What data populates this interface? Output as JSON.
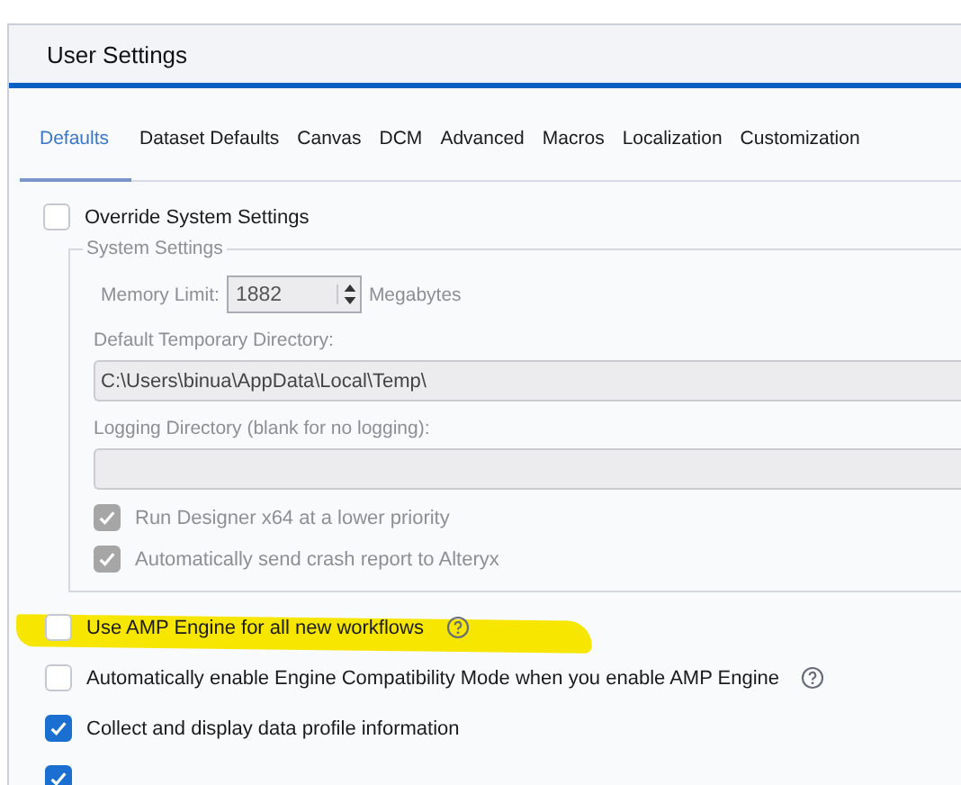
{
  "window": {
    "title": "User Settings"
  },
  "tabs": [
    {
      "label": "Defaults",
      "selected": true
    },
    {
      "label": "Dataset Defaults",
      "selected": false
    },
    {
      "label": "Canvas",
      "selected": false
    },
    {
      "label": "DCM",
      "selected": false
    },
    {
      "label": "Advanced",
      "selected": false
    },
    {
      "label": "Macros",
      "selected": false
    },
    {
      "label": "Localization",
      "selected": false
    },
    {
      "label": "Customization",
      "selected": false
    }
  ],
  "override": {
    "label": "Override System Settings",
    "checked": false
  },
  "system_settings": {
    "title": "System Settings",
    "disabled": true,
    "memory_limit": {
      "label": "Memory Limit:",
      "value": "1882",
      "unit": "Megabytes"
    },
    "temp_dir": {
      "label": "Default Temporary Directory:",
      "value": "C:\\Users\\binua\\AppData\\Local\\Temp\\"
    },
    "log_dir": {
      "label": "Logging Directory (blank for no logging):"
    },
    "options": [
      {
        "label": "Run Designer x64 at a lower priority",
        "checked": true
      },
      {
        "label": "Automatically send crash report to Alteryx",
        "checked": true
      }
    ]
  },
  "options": [
    {
      "label": "Use AMP Engine for all new workflows",
      "checked": false,
      "help": true,
      "highlight": true
    },
    {
      "label": "Automatically enable Engine Compatibility Mode when you enable AMP Engine",
      "checked": false,
      "help": true,
      "highlight": false
    },
    {
      "label": "Collect and display data profile information",
      "checked": true,
      "help": false,
      "highlight": false
    },
    {
      "checked": true,
      "help": false,
      "highlight": false
    }
  ]
}
